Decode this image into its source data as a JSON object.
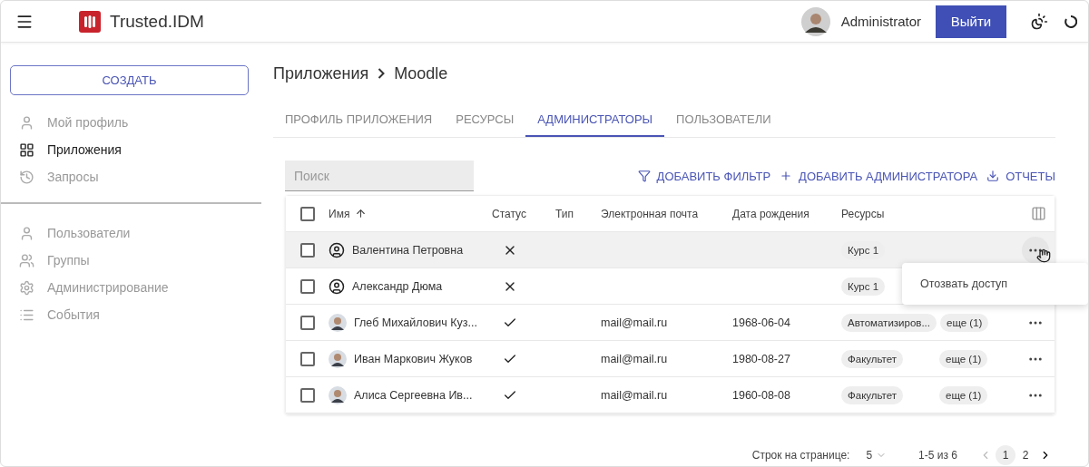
{
  "header": {
    "app_name": "Trusted.IDM",
    "user_name": "Administrator",
    "logout_button": "Выйти"
  },
  "sidebar": {
    "create_button": "СОЗДАТЬ",
    "groups": [
      [
        {
          "label": "Мой профиль",
          "selected": false
        },
        {
          "label": "Приложения",
          "selected": true
        },
        {
          "label": "Запросы",
          "selected": false
        }
      ],
      [
        {
          "label": "Пользователи",
          "selected": false
        },
        {
          "label": "Группы",
          "selected": false
        },
        {
          "label": "Администрирование",
          "selected": false
        },
        {
          "label": "События",
          "selected": false
        }
      ]
    ]
  },
  "breadcrumb": [
    "Приложения",
    "Moodle"
  ],
  "tabs": [
    {
      "label": "ПРОФИЛЬ ПРИЛОЖЕНИЯ",
      "selected": false
    },
    {
      "label": "РЕСУРСЫ",
      "selected": false
    },
    {
      "label": "АДМИНИСТРАТОРЫ",
      "selected": true
    },
    {
      "label": "ПОЛЬЗОВАТЕЛИ",
      "selected": false
    }
  ],
  "search": {
    "placeholder": "Поиск"
  },
  "actions": [
    "ДОБАВИТЬ ФИЛЬТР",
    "ДОБАВИТЬ АДМИНИСТРАТОРА",
    "ОТЧЕТЫ"
  ],
  "table": {
    "all_checked": false,
    "columns": [
      "Имя",
      "Статус",
      "Тип",
      "Электронная почта",
      "Дата рождения",
      "Ресурсы"
    ],
    "rows": [
      {
        "checked": false,
        "highlighted": true,
        "menu_open": true,
        "kind": "icon",
        "name": "Валентина Петровна",
        "active": false,
        "email": "",
        "birth_date": "",
        "resources": [
          "Курс 1"
        ],
        "more": ""
      },
      {
        "checked": false,
        "highlighted": false,
        "kind": "icon",
        "name": "Александр Дюма",
        "active": false,
        "email": "",
        "birth_date": "",
        "resources": [
          "Курс 1"
        ],
        "more": ""
      },
      {
        "checked": false,
        "highlighted": false,
        "name": "Глеб Михайлович Куз...",
        "active": true,
        "email": "mail@mail.ru",
        "birth_date": "1968-06-04",
        "resources": [
          "Автоматизиров..."
        ],
        "more": "еще (1)"
      },
      {
        "checked": false,
        "highlighted": false,
        "name": "Иван Маркович Жуков",
        "active": true,
        "email": "mail@mail.ru",
        "birth_date": "1980-08-27",
        "resources": [
          "Факультет"
        ],
        "more": "еще (1)"
      },
      {
        "checked": false,
        "highlighted": false,
        "name": "Алиса Сергеевна Ив...",
        "active": true,
        "email": "mail@mail.ru",
        "birth_date": "1960-08-08",
        "resources": [
          "Факультет"
        ],
        "more": "еще (1)"
      }
    ]
  },
  "row_menu": {
    "items": [
      "Отозвать доступ"
    ]
  },
  "pagination": {
    "rows_label": "Строк на странице:",
    "rows_value": "5",
    "range": "1-5 из 6",
    "pages": [
      {
        "label": "1",
        "selected": true
      },
      {
        "label": "2",
        "selected": false
      }
    ]
  }
}
